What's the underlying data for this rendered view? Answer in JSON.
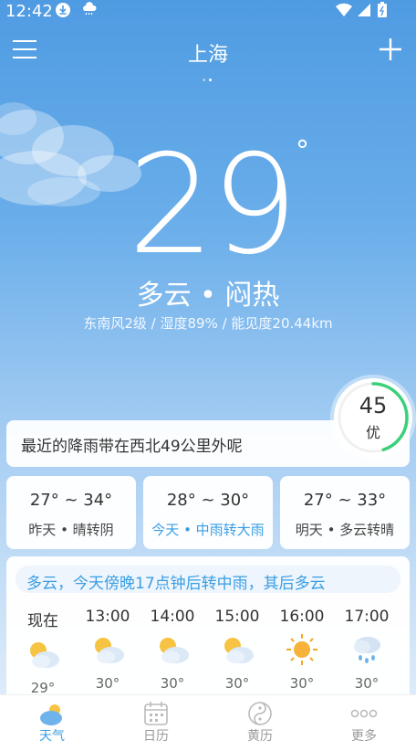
{
  "status_bar": {
    "time": "12:42"
  },
  "header": {
    "city": "上海"
  },
  "current": {
    "temperature": "29",
    "degree_symbol": "°",
    "condition": "多云 • 闷热",
    "details": "东南风2级 / 湿度89% / 能见度20.44km"
  },
  "aqi": {
    "value": "45",
    "level": "优",
    "fraction": 0.45,
    "color": "#3ad07a"
  },
  "rain_notice": "最近的降雨带在西北49公里外呢",
  "days": [
    {
      "range": "27° ~ 34°",
      "desc": "昨天 • 晴转阴"
    },
    {
      "range": "28° ~ 30°",
      "desc": "今天 • 中雨转大雨"
    },
    {
      "range": "27° ~ 33°",
      "desc": "明天 • 多云转晴"
    }
  ],
  "hourly": {
    "summary": "多云，今天傍晚17点钟后转中雨，其后多云",
    "items": [
      {
        "time": "现在",
        "icon": "partly-cloudy-icon",
        "temp": "29°"
      },
      {
        "time": "13:00",
        "icon": "partly-cloudy-icon",
        "temp": "30°"
      },
      {
        "time": "14:00",
        "icon": "partly-cloudy-icon",
        "temp": "30°"
      },
      {
        "time": "15:00",
        "icon": "partly-cloudy-icon",
        "temp": "30°"
      },
      {
        "time": "16:00",
        "icon": "sun-icon",
        "temp": "30°"
      },
      {
        "time": "17:00",
        "icon": "rain-icon",
        "temp": "30°"
      }
    ]
  },
  "nav": [
    {
      "label": "天气",
      "icon": "weather-icon",
      "active": true
    },
    {
      "label": "日历",
      "icon": "calendar-icon",
      "active": false
    },
    {
      "label": "黄历",
      "icon": "almanac-icon",
      "active": false
    },
    {
      "label": "更多",
      "icon": "more-icon",
      "active": false
    }
  ],
  "colors": {
    "accent": "#3a9ee4",
    "sky_top": "#4f9be2"
  }
}
